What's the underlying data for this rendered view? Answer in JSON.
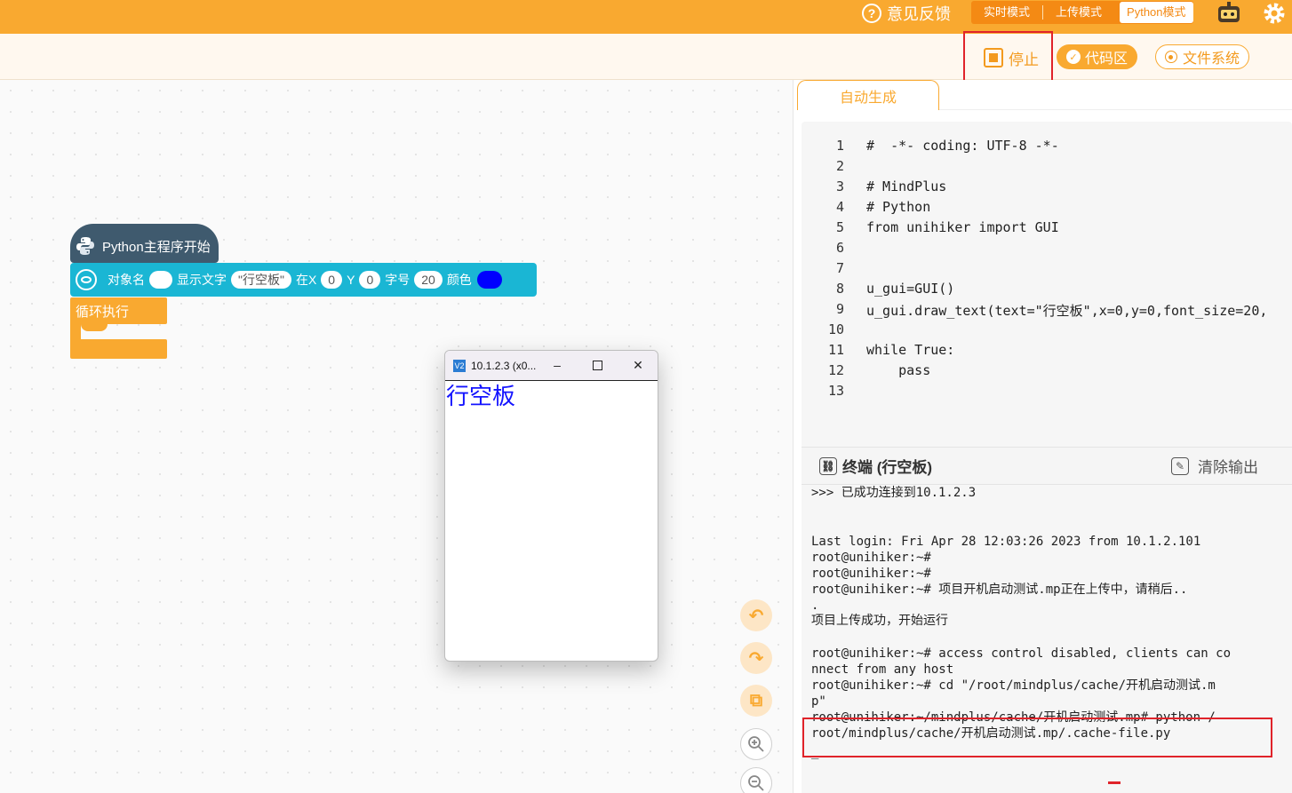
{
  "topbar": {
    "feedback": "意见反馈",
    "modes": [
      "实时模式",
      "上传模式",
      "Python模式"
    ],
    "active_mode": "Python模式"
  },
  "toolbar": {
    "stop": "停止",
    "code_area": "代码区",
    "file_system": "文件系统"
  },
  "blocks": {
    "hat": "Python主程序开始",
    "stmt": {
      "obj_label": "对象名",
      "text_label": "显示文字",
      "text_value": "\"行空板\"",
      "x_label": "在X",
      "x_value": "0",
      "y_label": "Y",
      "y_value": "0",
      "size_label": "字号",
      "size_value": "20",
      "color_label": "颜色"
    },
    "loop": "循环执行"
  },
  "popup": {
    "title": "10.1.2.3 (x0...",
    "vnc": "V2",
    "content": "行空板"
  },
  "code": {
    "tab": "自动生成",
    "lines": [
      {
        "n": "1",
        "t": "#  -*- coding: UTF-8 -*-"
      },
      {
        "n": "2",
        "t": ""
      },
      {
        "n": "3",
        "t": "# MindPlus"
      },
      {
        "n": "4",
        "t": "# Python"
      },
      {
        "n": "5",
        "t": "from unihiker import GUI"
      },
      {
        "n": "6",
        "t": ""
      },
      {
        "n": "7",
        "t": ""
      },
      {
        "n": "8",
        "t": "u_gui=GUI()"
      },
      {
        "n": "9",
        "t": "u_gui.draw_text(text=\"行空板\",x=0,y=0,font_size=20,"
      },
      {
        "n": "10",
        "t": ""
      },
      {
        "n": "11",
        "t": "while True:"
      },
      {
        "n": "12",
        "t": "    pass"
      },
      {
        "n": "13",
        "t": ""
      }
    ]
  },
  "terminal": {
    "title": "终端 (行空板)",
    "clear": "清除输出",
    "lines": [
      ">>> 已成功连接到10.1.2.3",
      "",
      "",
      "Last login: Fri Apr 28 12:03:26 2023 from 10.1.2.101",
      "root@unihiker:~#",
      "root@unihiker:~#",
      "root@unihiker:~# 项目开机启动测试.mp正在上传中，请稍后..",
      ".",
      "项目上传成功，开始运行",
      "",
      "root@unihiker:~# access control disabled, clients can co",
      "nnect from any host",
      "root@unihiker:~# cd \"/root/mindplus/cache/开机启动测试.m",
      "p\"",
      "root@unihiker:~/mindplus/cache/开机启动测试.mp# python /",
      "root/mindplus/cache/开机启动测试.mp/.cache-file.py",
      "",
      "_"
    ]
  },
  "colors": {
    "accent": "#f9a930",
    "block_blue": "#1ab6d4",
    "highlight_red": "#e0232a",
    "text_blue": "#1414ff"
  }
}
